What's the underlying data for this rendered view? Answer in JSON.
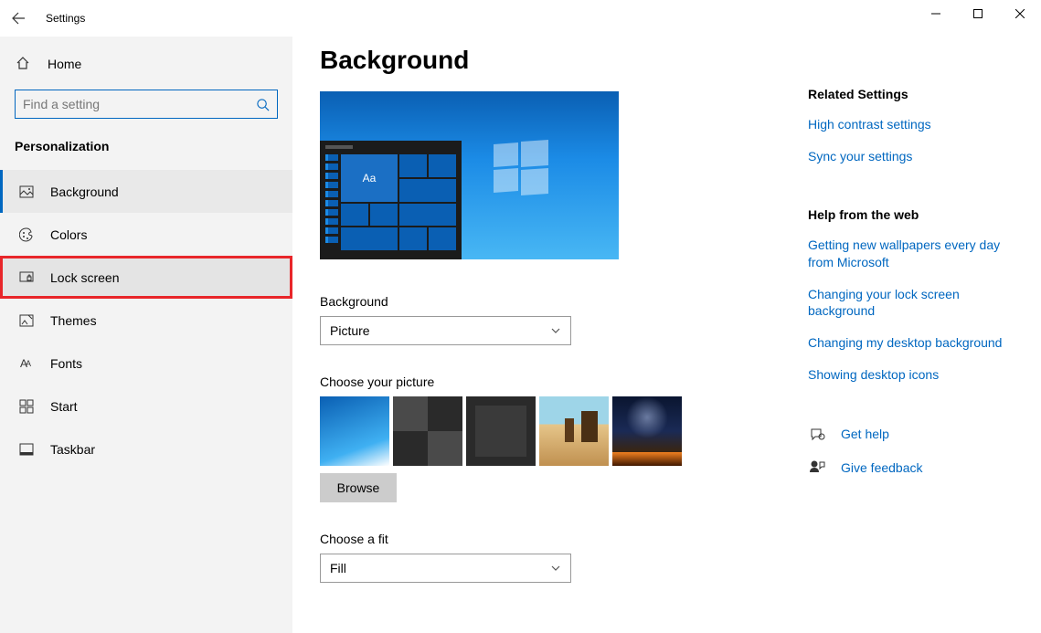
{
  "titlebar": {
    "title": "Settings"
  },
  "sidebar": {
    "home": "Home",
    "search_placeholder": "Find a setting",
    "section": "Personalization",
    "items": [
      {
        "label": "Background"
      },
      {
        "label": "Colors"
      },
      {
        "label": "Lock screen"
      },
      {
        "label": "Themes"
      },
      {
        "label": "Fonts"
      },
      {
        "label": "Start"
      },
      {
        "label": "Taskbar"
      }
    ]
  },
  "main": {
    "title": "Background",
    "preview_sample": "Aa",
    "bg_label": "Background",
    "bg_value": "Picture",
    "choose_picture_label": "Choose your picture",
    "browse_label": "Browse",
    "fit_label": "Choose a fit",
    "fit_value": "Fill"
  },
  "aside": {
    "related_heading": "Related Settings",
    "related_links": [
      "High contrast settings",
      "Sync your settings"
    ],
    "help_heading": "Help from the web",
    "help_links": [
      "Getting new wallpapers every day from Microsoft",
      "Changing your lock screen background",
      "Changing my desktop background",
      "Showing desktop icons"
    ],
    "get_help": "Get help",
    "give_feedback": "Give feedback"
  }
}
